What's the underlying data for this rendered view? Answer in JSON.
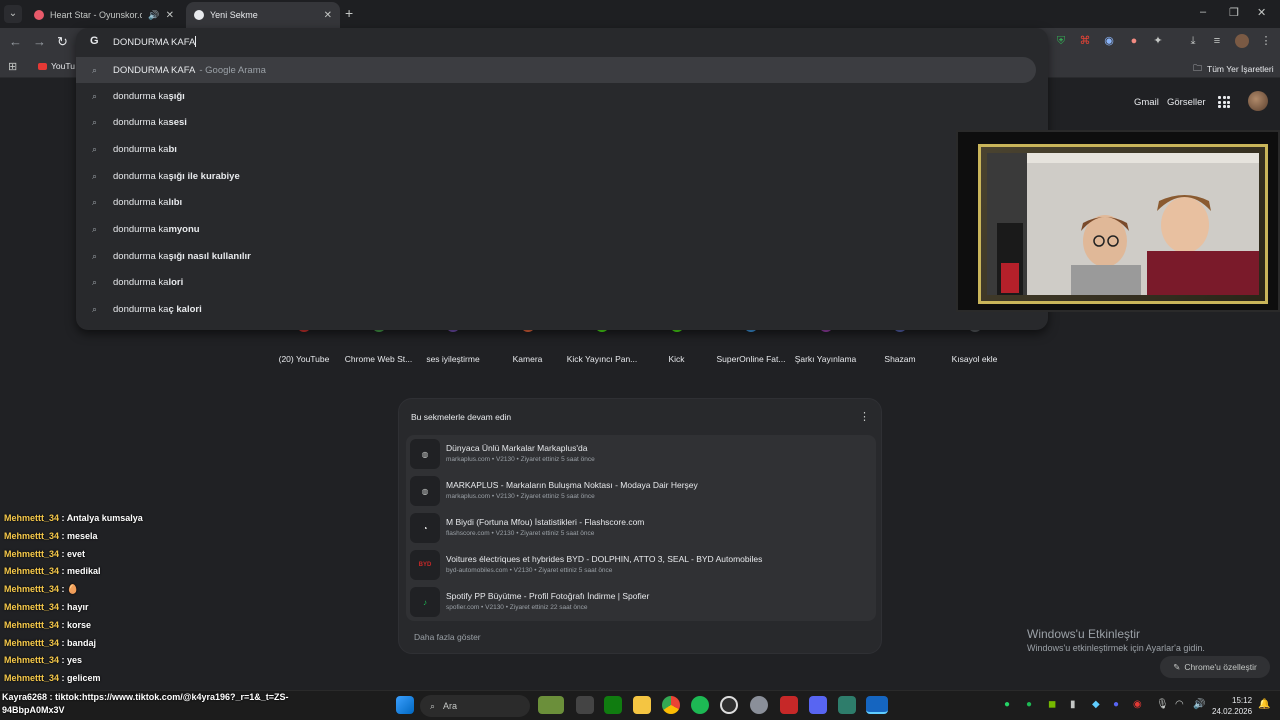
{
  "browser": {
    "tabs": [
      {
        "title": "Heart Star - Oyunskor.com",
        "favicon_color": "#e85a6a",
        "active": false
      },
      {
        "title": "Yeni Sekme",
        "favicon_color": "#e8eaed",
        "active": true
      }
    ],
    "omnibox": {
      "value": "DONDURMA KAFA",
      "suggestions": [
        {
          "typed": "DONDURMA KAFA",
          "completion": "",
          "suffix": "- Google Arama"
        },
        {
          "typed": "dondurma ka",
          "completion": "şığı",
          "suffix": ""
        },
        {
          "typed": "dondurma ka",
          "completion": "sesi",
          "suffix": ""
        },
        {
          "typed": "dondurma ka",
          "completion": "bı",
          "suffix": ""
        },
        {
          "typed": "dondurma ka",
          "completion": "şığı ile kurabiye",
          "suffix": ""
        },
        {
          "typed": "dondurma ka",
          "completion": "lıbı",
          "suffix": ""
        },
        {
          "typed": "dondurma ka",
          "completion": "myonu",
          "suffix": ""
        },
        {
          "typed": "dondurma ka",
          "completion": "şığı nasıl kullanılır",
          "suffix": ""
        },
        {
          "typed": "dondurma ka",
          "completion": "lori",
          "suffix": ""
        },
        {
          "typed": "dondurma ka",
          "completion": "ç kalori",
          "suffix": ""
        }
      ]
    },
    "bookmarks": {
      "first": "YouTu",
      "all_bookmarks": "Tüm Yer İşaretleri"
    }
  },
  "ntp": {
    "gmail": "Gmail",
    "images": "Görseller",
    "shortcuts": [
      {
        "label": "(20) YouTube",
        "color": "#e53935"
      },
      {
        "label": "Chrome Web St...",
        "color": "#4caf50"
      },
      {
        "label": "ses iyileştirme",
        "color": "#7e57c2"
      },
      {
        "label": "Kamera",
        "color": "#ff7043"
      },
      {
        "label": "Kick Yayıncı Pan...",
        "color": "#53fc18"
      },
      {
        "label": "Kick",
        "color": "#53fc18"
      },
      {
        "label": "SuperOnline Fat...",
        "color": "#42a5f5"
      },
      {
        "label": "Şarkı Yayınlama",
        "color": "#ab47bc"
      },
      {
        "label": "Shazam",
        "color": "#5c6bc0"
      },
      {
        "label": "Kısayol ekle",
        "color": "#5f6368"
      }
    ],
    "continue": {
      "title": "Bu sekmelerle devam edin",
      "items": [
        {
          "name": "Dünyaca Ünlü Markalar Markaplus'da",
          "meta": "markaplus.com • V2130 • Ziyaret ettiniz 5 saat önce"
        },
        {
          "name": "MARKAPLUS - Markaların Buluşma Noktası - Modaya Dair Herşey",
          "meta": "markaplus.com • V2130 • Ziyaret ettiniz 5 saat önce"
        },
        {
          "name": "M Biydi (Fortuna Mfou) İstatistikleri - Flashscore.com",
          "meta": "flashscore.com • V2130 • Ziyaret ettiniz 5 saat önce"
        },
        {
          "name": "Voitures électriques et hybrides BYD - DOLPHIN, ATTO 3, SEAL - BYD Automobiles",
          "meta": "byd-automobiles.com • V2130 • Ziyaret ettiniz 5 saat önce"
        },
        {
          "name": "Spotify PP Büyütme - Profil Fotoğrafı İndirme | Spofier",
          "meta": "spofier.com • V2130 • Ziyaret ettiniz 22 saat önce"
        }
      ],
      "more": "Daha fazla göster"
    },
    "customize": "Chrome'u özelleştir"
  },
  "watermark": {
    "title": "Windows'u Etkinleştir",
    "subtitle": "Windows'u etkinleştirmek için Ayarlar'a gidin."
  },
  "chat": [
    {
      "user": "Mehmettt_34",
      "msg": "Antalya kumsalya"
    },
    {
      "user": "Mehmettt_34",
      "msg": "mesela"
    },
    {
      "user": "Mehmettt_34",
      "msg": "evet"
    },
    {
      "user": "Mehmettt_34",
      "msg": "medikal"
    },
    {
      "user": "Mehmettt_34",
      "msg": "🥚"
    },
    {
      "user": "Mehmettt_34",
      "msg": "hayır"
    },
    {
      "user": "Mehmettt_34",
      "msg": "korse"
    },
    {
      "user": "Mehmettt_34",
      "msg": "bandaj"
    },
    {
      "user": "Mehmettt_34",
      "msg": "yes"
    },
    {
      "user": "Mehmettt_34",
      "msg": "gelicem"
    }
  ],
  "tiktok": {
    "line1": "Kayra6268 : tiktok:https://www.tiktok.com/@k4yra196?_r=1&_t=ZS-",
    "line2": "94BbpA0Mx3V"
  },
  "taskbar": {
    "search": "Ara",
    "time": "15:12",
    "date": "24.02.2026"
  }
}
